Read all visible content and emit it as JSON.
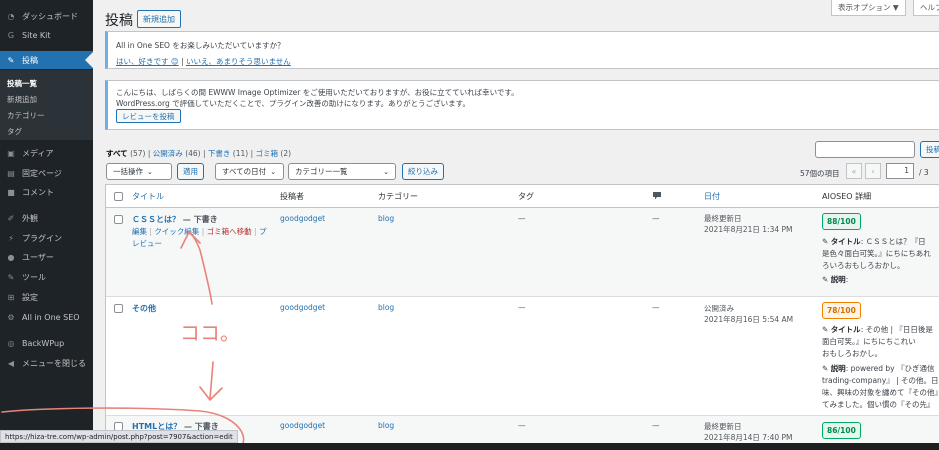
{
  "sidebar": {
    "dashboard": "ダッシュボード",
    "sitekit": "Site Kit",
    "posts": "投稿",
    "submenu": [
      "投稿一覧",
      "新規追加",
      "カテゴリー",
      "タグ"
    ],
    "media": "メディア",
    "pages": "固定ページ",
    "comments": "コメント",
    "appearance": "外観",
    "plugins": "プラグイン",
    "users": "ユーザー",
    "tools": "ツール",
    "settings": "設定",
    "aioseo": "All in One SEO",
    "backwpup": "BackWPup",
    "collapse": "メニューを閉じる"
  },
  "header": {
    "title": "投稿",
    "add_new": "新規追加",
    "screen_options": "表示オプション ▼",
    "help": "ヘルプ"
  },
  "notice1": {
    "question": "All in One SEO をお楽しみいただいていますか？",
    "yes": "はい、好きです 😊",
    "sep": "|",
    "no": "いいえ、あまりそう思いません"
  },
  "notice2": {
    "line1": "こんにちは、しばらくの間 EWWW Image Optimizer をご使用いただいておりますが、お役に立てていれば幸いです。",
    "line2": "WordPress.org で評価していただくことで、プラグイン改善の助けになります。ありがとうございます。",
    "button": "レビューを投稿"
  },
  "views": {
    "all": "すべて",
    "all_count": "(57)",
    "published": "公開済み",
    "published_count": "(46)",
    "drafts": "下書き",
    "drafts_count": "(11)",
    "trash": "ゴミ箱",
    "trash_count": "(2)"
  },
  "filters": {
    "bulk": "一括操作",
    "apply": "適用",
    "dates": "すべての日付",
    "categories": "カテゴリー一覧",
    "filter": "絞り込み",
    "search_button": "投稿"
  },
  "pagination": {
    "items": "57個の項目",
    "first": "«",
    "prev": "‹",
    "current": "1",
    "total": "/ 3"
  },
  "columns": {
    "title": "タイトル",
    "author": "投稿者",
    "category": "カテゴリー",
    "tags": "タグ",
    "date": "日付",
    "aioseo": "AIOSEO 詳細"
  },
  "rows": [
    {
      "title": "ＣＳＳとは？",
      "state": "— 下書き",
      "actions": {
        "edit": "編集",
        "quick": "クイック編集",
        "trash": "ゴミ箱へ移動",
        "preview_a": "プ",
        "preview_b": "レビュー"
      },
      "author": "goodgodget",
      "category": "blog",
      "tags": "—",
      "comments": "—",
      "date_status": "最終更新日",
      "date": "2021年8月21日 1:34 PM",
      "score": "88/100",
      "seo_title_label": "タイトル",
      "seo_title": ": ＣＳＳとは？『日",
      "seo_line2": "是色々面白可笑。』にちにちあれ",
      "seo_line3": "ろいろおもしろおかし。",
      "seo_desc_label": "説明",
      "seo_desc": ":"
    },
    {
      "title": "その他",
      "state": "",
      "author": "goodgodget",
      "category": "blog",
      "tags": "—",
      "comments": "—",
      "date_status": "公開済み",
      "date": "2021年8月16日 5:54 AM",
      "score": "78/100",
      "seo_title_label": "タイトル",
      "seo_title": ": その他 | 『日日後是",
      "seo_line2": "面白可笑。』にちにちこれい",
      "seo_line3": "おもしろおかし。",
      "seo_desc_label": "説明",
      "seo_desc": ": powered by 『ひぎ通信",
      "seo_line5": "trading-company』 | その他。日常",
      "seo_line6": "味、興味の対象を纏めて『その他』",
      "seo_line7": "てみました。個い慣の『その先』"
    },
    {
      "title": "HTMLとは？",
      "state": "— 下書き",
      "author": "goodgodget",
      "category": "blog",
      "tags": "—",
      "comments": "—",
      "date_status": "最終更新日",
      "date": "2021年8月14日 7:40 PM",
      "score": "86/100"
    }
  ],
  "annotation": {
    "text": "ココ。"
  },
  "statusbar": {
    "url": "https://hiza-tre.com/wp-admin/post.php?post=7907&action=edit"
  },
  "colors": {
    "admin_bar": "#1d2327",
    "accent": "#2271b1",
    "annotation": "#e8837a"
  }
}
